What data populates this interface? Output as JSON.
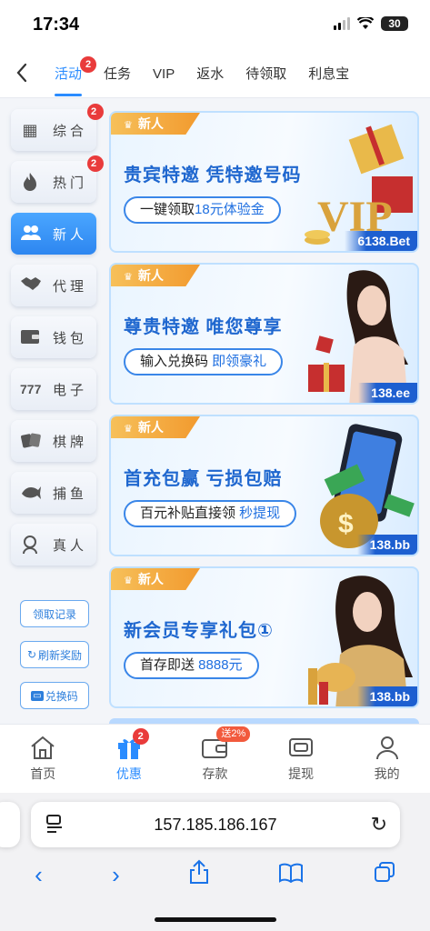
{
  "status": {
    "time": "17:34",
    "battery": "30"
  },
  "nav": {
    "tabs": [
      {
        "label": "活动",
        "badge": "2"
      },
      {
        "label": "任务"
      },
      {
        "label": "VIP"
      },
      {
        "label": "返水"
      },
      {
        "label": "待领取"
      },
      {
        "label": "利息宝"
      }
    ]
  },
  "sidebar": {
    "items": [
      {
        "label": "综合",
        "icon": "grid-icon",
        "badge": "2"
      },
      {
        "label": "热门",
        "icon": "flame-icon",
        "badge": "2"
      },
      {
        "label": "新人",
        "icon": "new-users-icon"
      },
      {
        "label": "代理",
        "icon": "handshake-icon"
      },
      {
        "label": "钱包",
        "icon": "wallet-icon"
      },
      {
        "label": "电子",
        "icon": "slot-777-icon"
      },
      {
        "label": "棋牌",
        "icon": "cards-icon"
      },
      {
        "label": "捕鱼",
        "icon": "fish-icon"
      },
      {
        "label": "真人",
        "icon": "live-dealer-icon"
      }
    ],
    "actions": [
      {
        "label": "领取记录"
      },
      {
        "label": "刷新奖励"
      },
      {
        "label": "兑换码"
      }
    ]
  },
  "banners": [
    {
      "tag": "新人",
      "title": "贵宾特邀 凭特邀号码",
      "pill_text": "一键领取",
      "pill_highlight": "18元体验金",
      "domain": "6138.Bet",
      "art": "vip-gift-art"
    },
    {
      "tag": "新人",
      "title": "尊贵特邀 唯您尊享",
      "pill_text": "输入兑换码 ",
      "pill_highlight": "即领豪礼",
      "domain": "138.ee",
      "art": "woman-casino-art"
    },
    {
      "tag": "新人",
      "title": "首充包赢 亏损包赔",
      "pill_text": "百元补贴直接领 ",
      "pill_highlight": "秒提现",
      "domain": "138.bb",
      "art": "phone-money-art"
    },
    {
      "tag": "新人",
      "title": "新会员专享礼包①",
      "pill_text": "首存即送 ",
      "pill_highlight": "8888元",
      "domain": "138.bb",
      "art": "woman-gold-art"
    }
  ],
  "bottom_tabs": [
    {
      "label": "首页",
      "icon": "home-icon"
    },
    {
      "label": "优惠",
      "icon": "gift-icon",
      "badge": "2"
    },
    {
      "label": "存款",
      "icon": "deposit-wallet-icon",
      "promo": "送2%"
    },
    {
      "label": "提现",
      "icon": "withdraw-icon"
    },
    {
      "label": "我的",
      "icon": "profile-icon"
    }
  ],
  "browser": {
    "url": "157.185.186.167"
  },
  "colors": {
    "accent": "#2a8cff",
    "badge": "#e93b3b",
    "banner_title": "#1f67cf",
    "tag_gold": "#f29a2e"
  }
}
